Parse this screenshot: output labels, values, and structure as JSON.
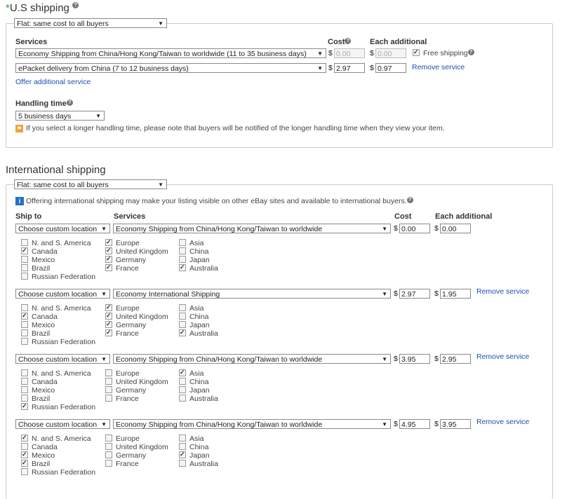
{
  "us": {
    "title": "U.S shipping",
    "required_mark": "*",
    "type_select": "Flat: same cost to all buyers",
    "col_services": "Services",
    "col_cost": "Cost",
    "col_each": "Each additional",
    "rows": [
      {
        "service": "Economy Shipping from China/Hong Kong/Taiwan to worldwide (11 to 35 business days)",
        "cost": "0.00",
        "each": "0.00",
        "free_label": "Free shipping",
        "free_checked": true
      },
      {
        "service": "ePacket delivery from China (7 to 12 business days)",
        "cost": "2.97",
        "each": "0.97",
        "remove": "Remove service"
      }
    ],
    "currency": "$",
    "offer_additional": "Offer additional service",
    "handling_label": "Handling time",
    "handling_value": "5 business days",
    "handling_note": "If you select a longer handling time, please note that buyers will be notified of the longer handling time when they view your item."
  },
  "intl": {
    "title": "International shipping",
    "type_select": "Flat: same cost to all buyers",
    "info": "Offering international shipping may make your listing visible on other eBay sites and available to international buyers.",
    "col_ship_to": "Ship to",
    "col_services": "Services",
    "col_cost": "Cost",
    "col_each": "Each additional",
    "currency": "$",
    "remove": "Remove service",
    "rows": [
      {
        "location": "Choose custom location",
        "service": "Economy Shipping from China/Hong Kong/Taiwan to worldwide",
        "cost": "0.00",
        "each": "0.00",
        "has_remove": false,
        "regions": [
          [
            "N. and S. America",
            false
          ],
          [
            "Canada",
            true
          ],
          [
            "Mexico",
            false
          ],
          [
            "Brazil",
            false
          ],
          [
            "Russian Federation",
            false
          ],
          [
            "Europe",
            true
          ],
          [
            "United Kingdom",
            true
          ],
          [
            "Germany",
            true
          ],
          [
            "France",
            true
          ],
          [
            "Asia",
            false
          ],
          [
            "China",
            false
          ],
          [
            "Japan",
            false
          ],
          [
            "Australia",
            true
          ]
        ]
      },
      {
        "location": "Choose custom location",
        "service": "Economy International Shipping",
        "cost": "2.97",
        "each": "1.95",
        "has_remove": true,
        "regions": [
          [
            "N. and S. America",
            false
          ],
          [
            "Canada",
            true
          ],
          [
            "Mexico",
            false
          ],
          [
            "Brazil",
            false
          ],
          [
            "Russian Federation",
            false
          ],
          [
            "Europe",
            true
          ],
          [
            "United Kingdom",
            true
          ],
          [
            "Germany",
            true
          ],
          [
            "France",
            true
          ],
          [
            "Asia",
            false
          ],
          [
            "China",
            false
          ],
          [
            "Japan",
            false
          ],
          [
            "Australia",
            true
          ]
        ]
      },
      {
        "location": "Choose custom location",
        "service": "Economy Shipping from China/Hong Kong/Taiwan to worldwide",
        "cost": "3.95",
        "each": "2.95",
        "has_remove": true,
        "regions": [
          [
            "N. and S. America",
            false
          ],
          [
            "Canada",
            false
          ],
          [
            "Mexico",
            false
          ],
          [
            "Brazil",
            false
          ],
          [
            "Russian Federation",
            true
          ],
          [
            "Europe",
            false
          ],
          [
            "United Kingdom",
            false
          ],
          [
            "Germany",
            false
          ],
          [
            "France",
            false
          ],
          [
            "Asia",
            true
          ],
          [
            "China",
            false
          ],
          [
            "Japan",
            false
          ],
          [
            "Australia",
            false
          ]
        ]
      },
      {
        "location": "Choose custom location",
        "service": "Economy Shipping from China/Hong Kong/Taiwan to worldwide",
        "cost": "4.95",
        "each": "3.95",
        "has_remove": true,
        "regions": [
          [
            "N. and S. America",
            true
          ],
          [
            "Canada",
            false
          ],
          [
            "Mexico",
            true
          ],
          [
            "Brazil",
            true
          ],
          [
            "Russian Federation",
            false
          ],
          [
            "Europe",
            false
          ],
          [
            "United Kingdom",
            false
          ],
          [
            "Germany",
            false
          ],
          [
            "France",
            false
          ],
          [
            "Asia",
            false
          ],
          [
            "China",
            false
          ],
          [
            "Japan",
            true
          ],
          [
            "Australia",
            false
          ]
        ]
      }
    ]
  },
  "icons": {
    "help": "help-icon",
    "tip": "tip-flag-icon",
    "info": "info-icon",
    "dropdown": "dropdown-arrow-icon"
  },
  "colors": {
    "link": "#1a4fb5",
    "tip": "#f2a33a",
    "info": "#2670c9",
    "required": "#2b9a2b"
  }
}
